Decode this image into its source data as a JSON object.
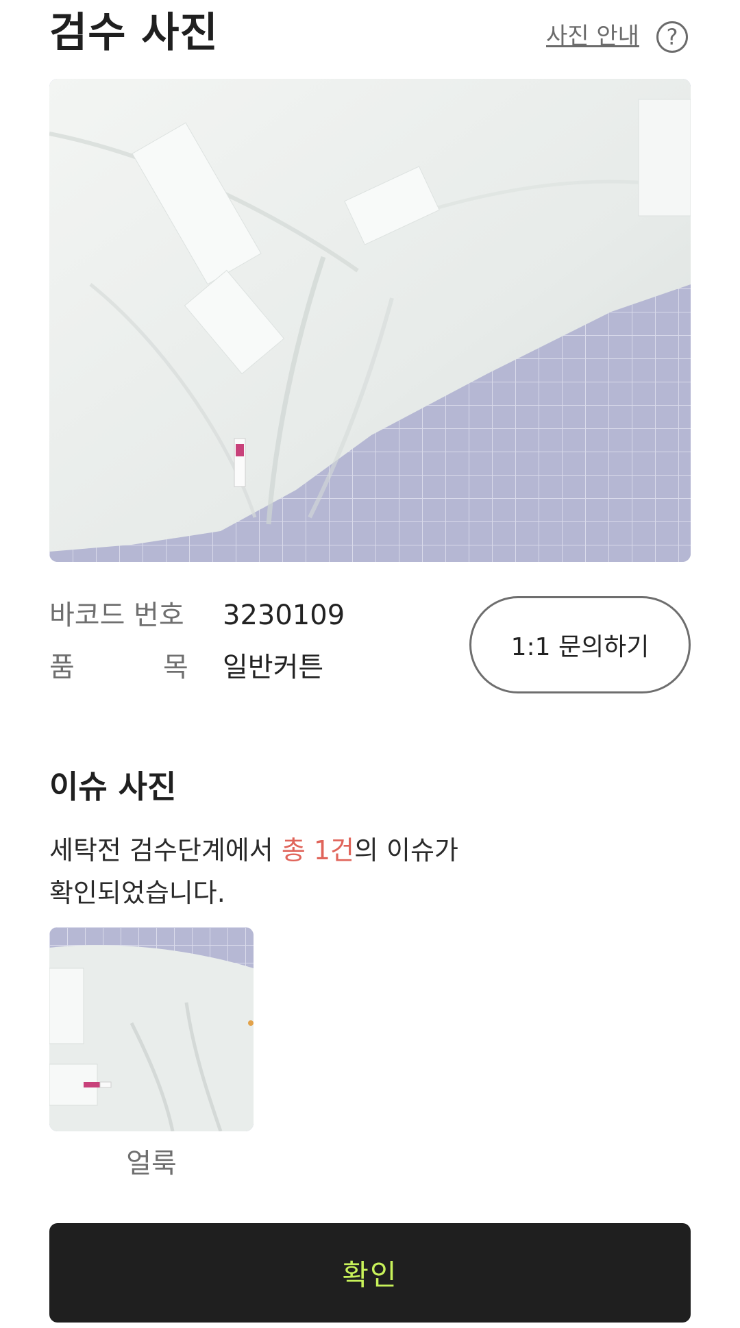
{
  "header": {
    "title": "검수 사진",
    "guide_link": "사진 안내",
    "help_icon": "?"
  },
  "main_photo": {
    "icon": "garment-photo",
    "description_colors": {
      "background": "#b7b9d4",
      "fabric": "#eef1ef"
    }
  },
  "info": {
    "barcode_label": "바코드 번호",
    "barcode_value": "3230109",
    "item_label_first": "품",
    "item_label_last": "목",
    "item_value": "일반커튼",
    "inquiry_button": "1:1 문의하기"
  },
  "issues": {
    "title": "이슈 사진",
    "desc_prefix": "세탁전 검수단계에서 ",
    "desc_highlight_1": "총 ",
    "desc_highlight_2": "1건",
    "desc_suffix": "의 이슈가",
    "desc_line2": "확인되었습니다.",
    "items": [
      {
        "caption": "얼룩"
      }
    ],
    "highlight_color": "#e0645a"
  },
  "footer": {
    "confirm_button": "확인",
    "button_bg": "#1f1f1f",
    "button_text_color": "#c8f25a"
  }
}
